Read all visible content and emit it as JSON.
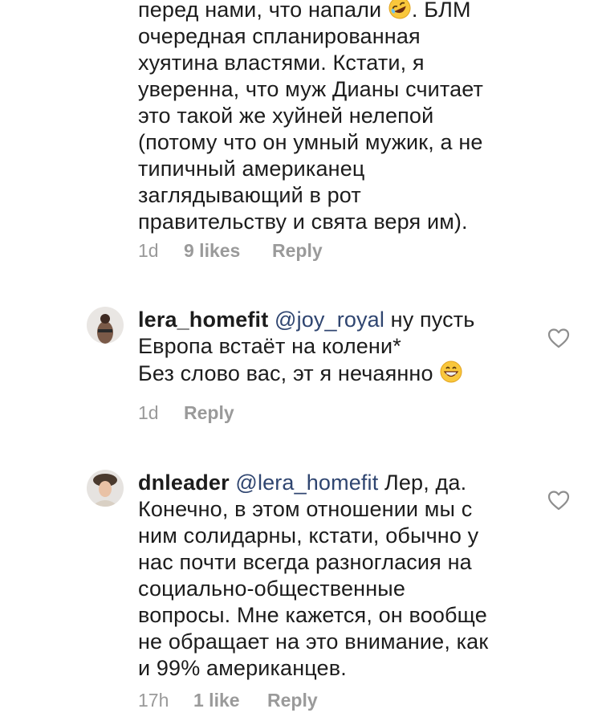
{
  "comment1": {
    "text_line1": "перед нами, что напали",
    "text_line1_tail": ". БЛМ",
    "text_rest": "очередная спланированная\nхуятина властями. Кстати, я\nуверенна, что муж Дианы считает\nэто такой же хуйней нелепой\n(потому что он умный мужик, а не\nтипичный американец\nзаглядывающий в рот\nправительству и свята веря им).",
    "emoji": "rofl-emoji",
    "time": "1d",
    "likes": "9 likes",
    "reply": "Reply"
  },
  "comment2": {
    "username": "lera_homefit",
    "mention": "@joy_royal",
    "text_after_mention": " ну пусть",
    "text_line2": "Европа встаёт на колени*",
    "text_line3": "Без слово вас, эт я нечаянно",
    "emoji": "grinning-emoji",
    "time": "1d",
    "reply": "Reply"
  },
  "comment3": {
    "username": "dnleader",
    "mention": "@lera_homefit",
    "text_after_mention": " Лер, да.",
    "text_rest": "Конечно, в этом отношении мы с\nним солидарны, кстати, обычно у\nнас почти всегда разногласия на\nсоциально-общественные\nвопросы. Мне кажется, он вообще\nне обращает на это внимание, как\nи 99% американцев.",
    "time": "17h",
    "likes": "1 like",
    "reply": "Reply"
  },
  "colors": {
    "text": "#1c1c1c",
    "mention": "#2f4570",
    "meta": "#9a9a9a",
    "heart": "#8e8e8e"
  }
}
